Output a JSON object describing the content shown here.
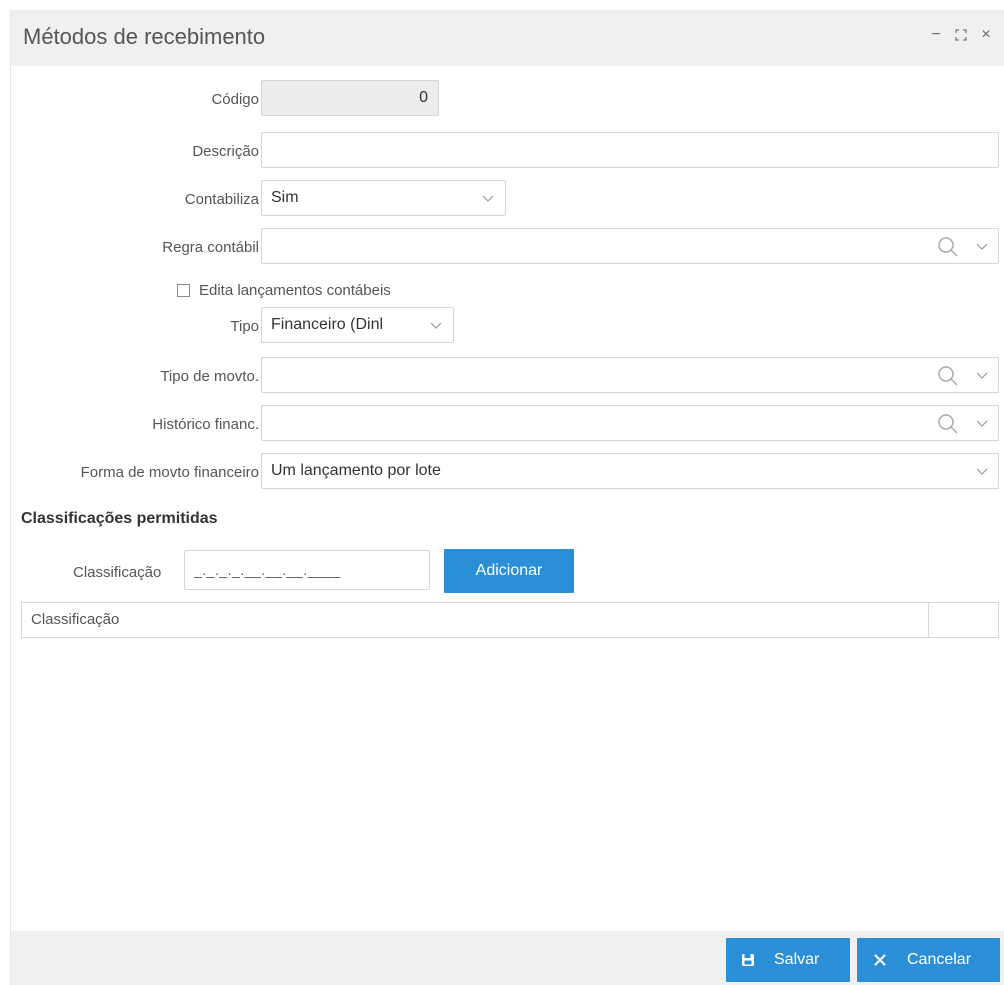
{
  "window": {
    "title": "Métodos de recebimento",
    "minimize": "−",
    "maximize": "⛶",
    "close": "×"
  },
  "form": {
    "codigo": {
      "label": "Código",
      "value": "0"
    },
    "descricao": {
      "label": "Descrição",
      "value": ""
    },
    "contabiliza": {
      "label": "Contabiliza",
      "value": "Sim"
    },
    "regra_contabil": {
      "label": "Regra contábil",
      "value": ""
    },
    "edita_lancamentos": {
      "label": "Edita lançamentos contábeis",
      "checked": false
    },
    "tipo": {
      "label": "Tipo",
      "value": "Financeiro (Dinl"
    },
    "tipo_movto": {
      "label": "Tipo de movto.",
      "value": ""
    },
    "historico_financ": {
      "label": "Histórico financ.",
      "value": ""
    },
    "forma_movto": {
      "label": "Forma de movto financeiro",
      "value": "Um lançamento por lote"
    }
  },
  "classificacoes": {
    "section_title": "Classificações permitidas",
    "field_label": "Classificação",
    "field_mask": "_._._._.__.__.__.____",
    "add_button": "Adicionar",
    "grid_columns": [
      "Classificação"
    ]
  },
  "footer": {
    "save_label": "Salvar",
    "cancel_label": "Cancelar"
  },
  "colors": {
    "primary": "#2a8fd6",
    "titlebar_bg": "#f0f0f0",
    "border": "#d6d6d6"
  }
}
